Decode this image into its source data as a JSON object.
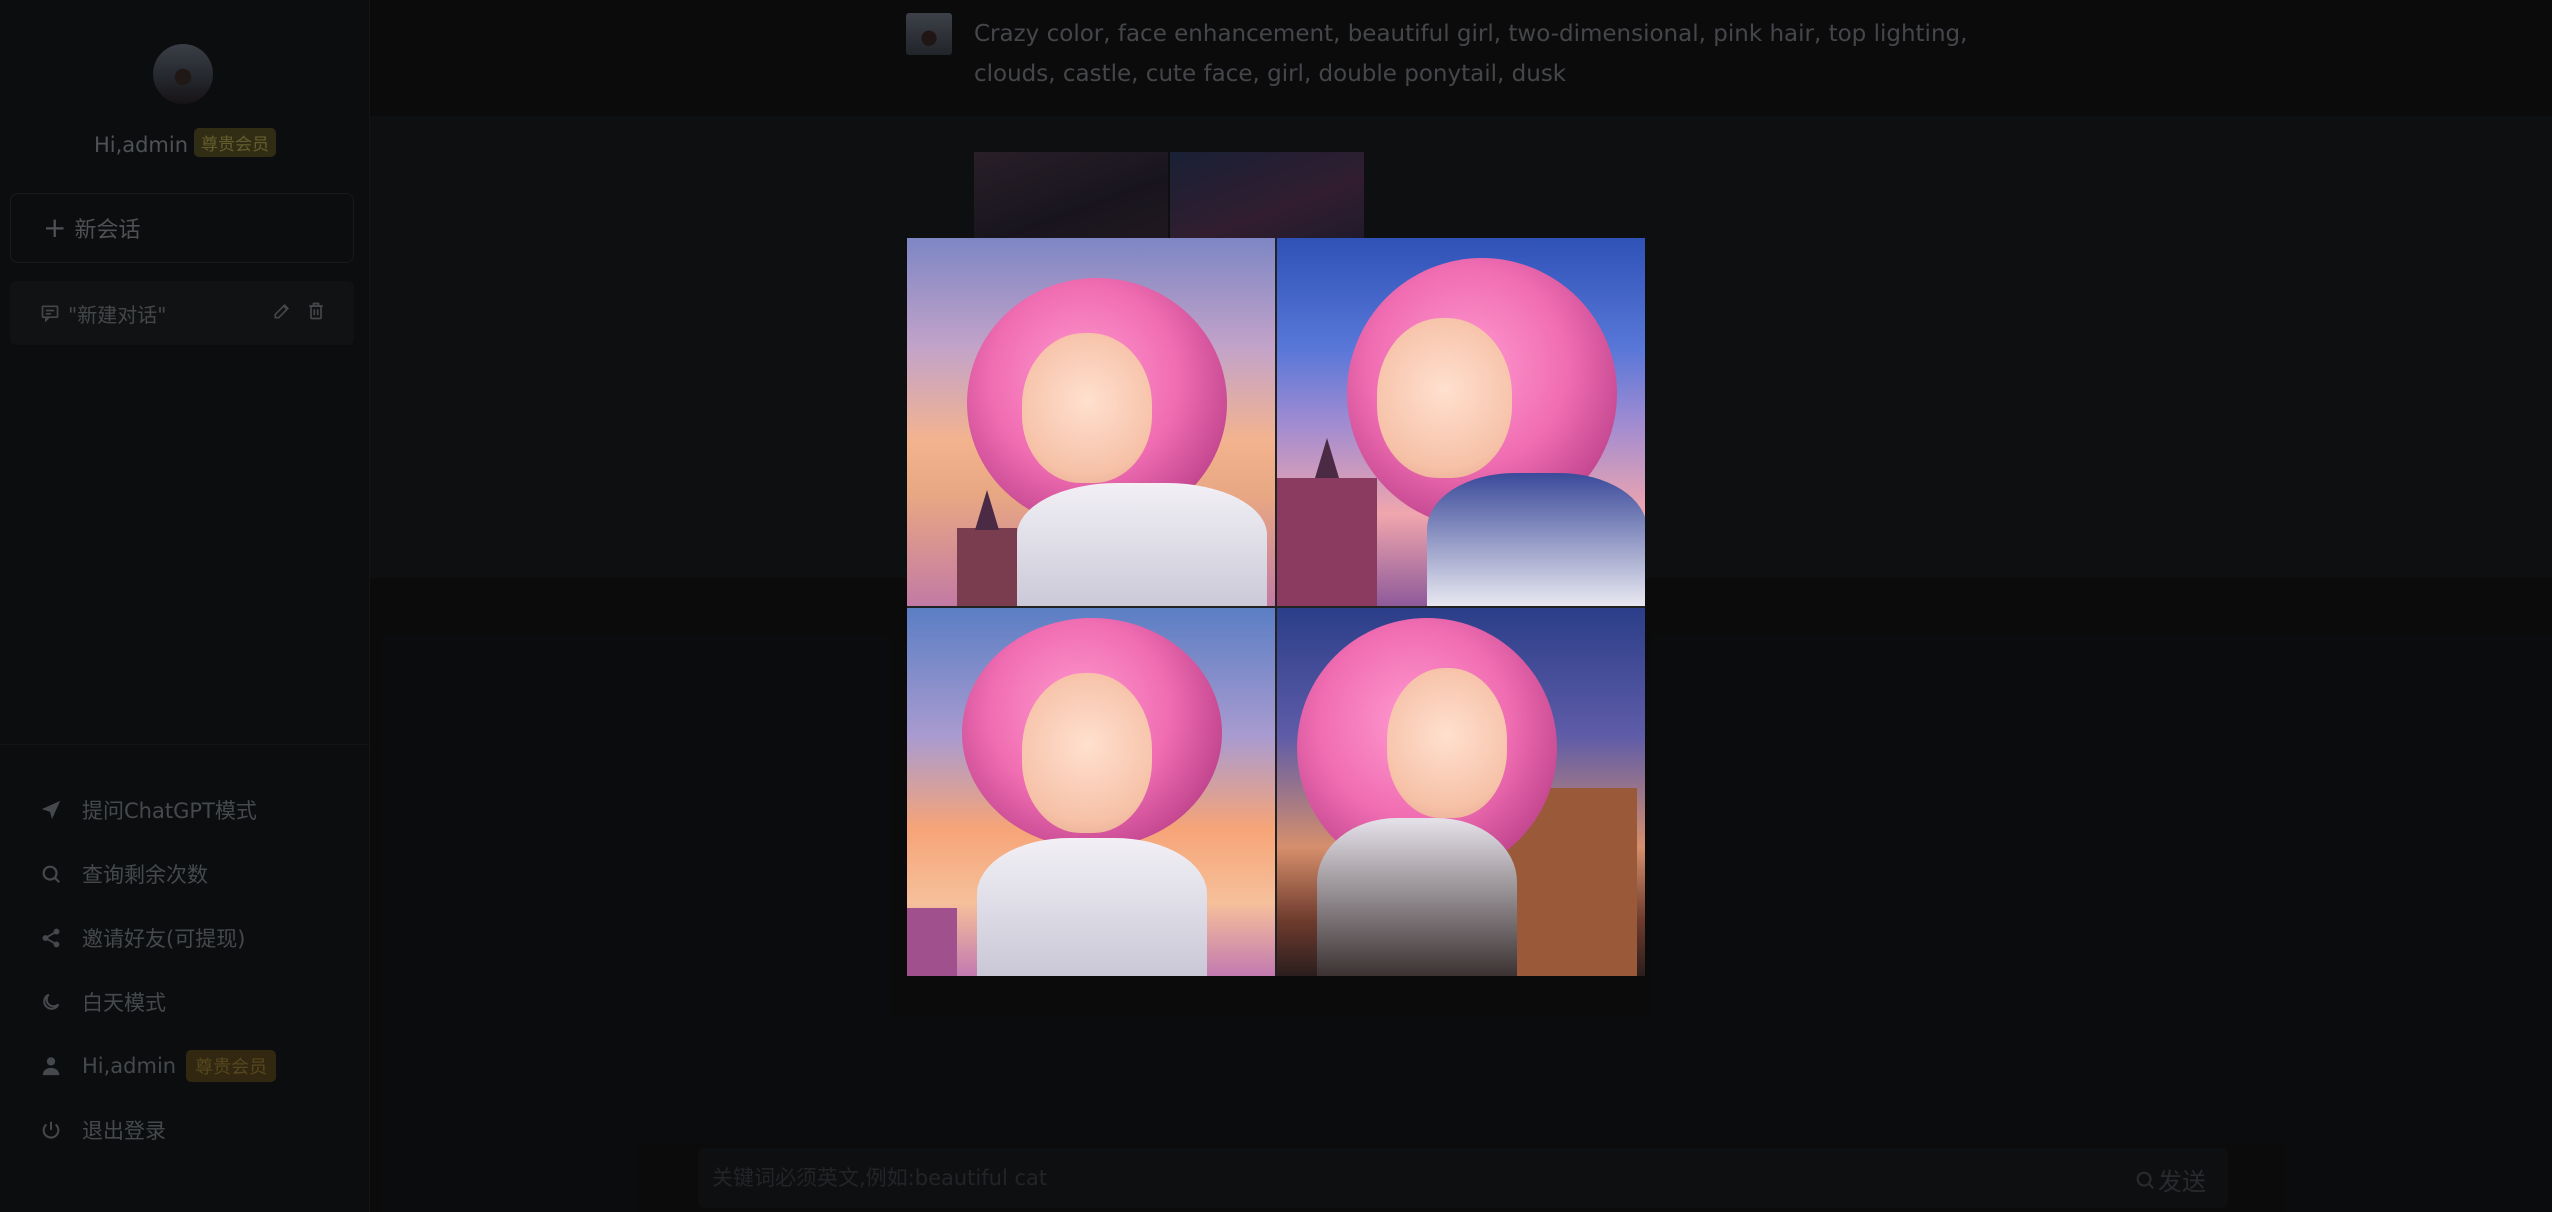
{
  "sidebar": {
    "greeting": "Hi,admin",
    "badge": "尊贵会员",
    "new_chat_label": "新会话",
    "conversation": {
      "title": "\"新建对话\""
    },
    "menu": [
      {
        "label": "提问ChatGPT模式",
        "icon": "send-icon"
      },
      {
        "label": "查询剩余次数",
        "icon": "search-icon"
      },
      {
        "label": "邀请好友(可提现)",
        "icon": "share-icon"
      },
      {
        "label": "白天模式",
        "icon": "moon-icon"
      },
      {
        "label": "Hi,admin",
        "icon": "user-icon",
        "badge": "尊贵会员"
      },
      {
        "label": "退出登录",
        "icon": "power-icon"
      }
    ]
  },
  "chat": {
    "user_prompt": "Crazy color, face enhancement, beautiful girl, two-dimensional, pink hair, top lighting, clouds, castle, cute face, girl, double ponytail, dusk"
  },
  "input": {
    "placeholder": "关键词必须英文,例如:beautiful cat",
    "send_label": "发送"
  },
  "colors": {
    "sidebar_bg": "#17191c",
    "main_bg": "#141517",
    "badge_bg": "#5a5226",
    "badge_text": "#b8a855"
  }
}
